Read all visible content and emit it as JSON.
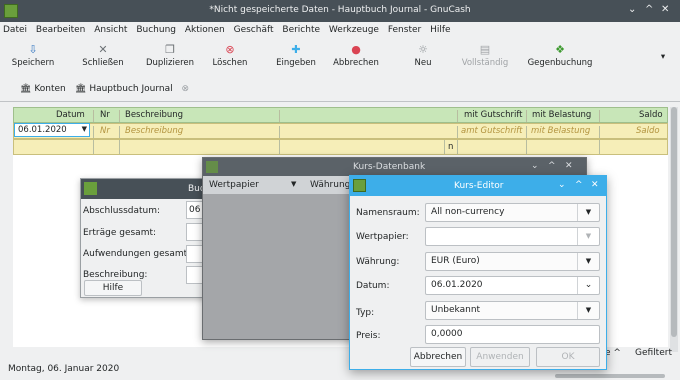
{
  "window": {
    "title": "*Nicht gespeicherte Daten - Hauptbuch Journal - GnuCash",
    "controls": [
      "⌄",
      "^",
      "✕"
    ]
  },
  "menu": [
    "Datei",
    "Bearbeiten",
    "Ansicht",
    "Buchung",
    "Aktionen",
    "Geschäft",
    "Berichte",
    "Werkzeuge",
    "Fenster",
    "Hilfe"
  ],
  "toolbar": {
    "save": "Speichern",
    "close": "Schließen",
    "duplicate": "Duplizieren",
    "delete": "Löschen",
    "enter": "Eingeben",
    "cancel": "Abbrechen",
    "new": "Neu",
    "complete": "Vollständig",
    "counter": "Gegenbuchung",
    "overflow": "▾"
  },
  "tabs": {
    "accounts": "Konten",
    "journal": "Hauptbuch Journal"
  },
  "register": {
    "headers": {
      "date": "Datum",
      "num": "Nr",
      "desc": "Beschreibung",
      "credit": "mit Gutschrift",
      "debit": "mit Belastung",
      "balance": "Saldo"
    },
    "row": {
      "date": "06.01.2020",
      "num": "Nr",
      "desc": "Beschreibung",
      "credit": "amt Gutschrift",
      "debit": "mit Belastung",
      "balance": "Saldo"
    },
    "row2_marker": "n"
  },
  "status": {
    "date": "Montag, 06. Januar 2020",
    "filter": "Gefiltert",
    "partial": "e ^"
  },
  "budget_win": {
    "title_partial": "Bud",
    "labels": {
      "closing": "Abschlussdatum:",
      "income": "Erträge gesamt:",
      "expenses": "Aufwendungen gesamt:",
      "desc": "Beschreibung:"
    },
    "closing_partial": "06",
    "help": "Hilfe"
  },
  "price_db": {
    "title": "Kurs-Datenbank",
    "col_security": "Wertpapier",
    "col_currency": "Währung",
    "controls": [
      "⌄",
      "^",
      "✕"
    ]
  },
  "price_editor": {
    "title": "Kurs-Editor",
    "controls": [
      "⌄",
      "^",
      "✕"
    ],
    "fields": {
      "namespace_label": "Namensraum:",
      "namespace": "All non-currency",
      "security_label": "Wertpapier:",
      "security": "",
      "currency_label": "Währung:",
      "currency": "EUR (Euro)",
      "date_label": "Datum:",
      "date": "06.01.2020",
      "type_label": "Typ:",
      "type": "Unbekannt",
      "price_label": "Preis:",
      "price": "0,0000"
    },
    "buttons": {
      "cancel": "Abbrechen",
      "apply": "Anwenden",
      "ok": "OK"
    }
  }
}
